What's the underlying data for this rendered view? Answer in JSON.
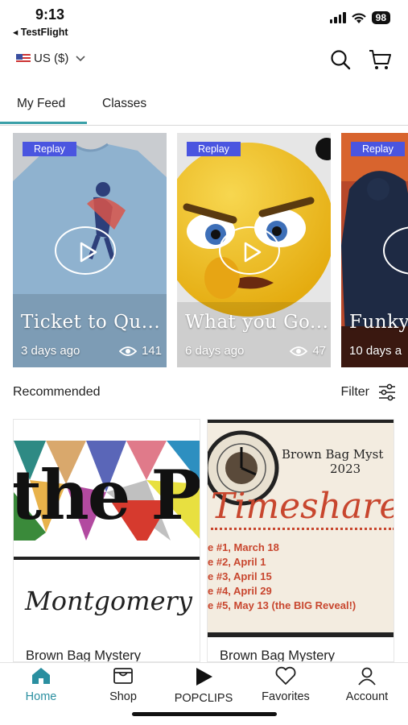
{
  "status_bar": {
    "time": "9:13",
    "back_app": "◂ TestFlight",
    "battery": "98"
  },
  "header": {
    "currency": "US ($)"
  },
  "tabs": [
    {
      "label": "My Feed",
      "active": true
    },
    {
      "label": "Classes",
      "active": false
    }
  ],
  "feed": [
    {
      "badge": "Replay",
      "title": "Ticket to Qu...",
      "age": "3 days ago",
      "views": "141"
    },
    {
      "badge": "Replay",
      "title": "What you Go...",
      "age": "6 days ago",
      "views": "47"
    },
    {
      "badge": "Replay",
      "title": "Funky",
      "age": "10 days a"
    }
  ],
  "recommended": {
    "title": "Recommended",
    "filter_label": "Filter",
    "products": [
      {
        "name": "Brown Bag Mystery",
        "art_word_1": "the P",
        "art_word_2": "Montgomery"
      },
      {
        "name": "Brown Bag Mystery",
        "art_heading": "Brown Bag Myst",
        "art_year": "2023",
        "art_title": "Timeshare",
        "art_lines": [
          "e #1, March 18",
          "e #2, April 1",
          "e #3, April 15",
          "e #4, April 29",
          "e #5, May 13 (the BIG Reveal!)"
        ]
      }
    ]
  },
  "bottom_nav": [
    {
      "label": "Home",
      "icon": "home-icon",
      "active": true
    },
    {
      "label": "Shop",
      "icon": "shop-icon"
    },
    {
      "label": "POPCLIPS",
      "icon": "play-icon"
    },
    {
      "label": "Favorites",
      "icon": "heart-icon"
    },
    {
      "label": "Account",
      "icon": "person-icon"
    }
  ],
  "colors": {
    "accent": "#2a8fa0",
    "badge": "#4a55e0",
    "tab_underline": "#3aa0a8"
  }
}
